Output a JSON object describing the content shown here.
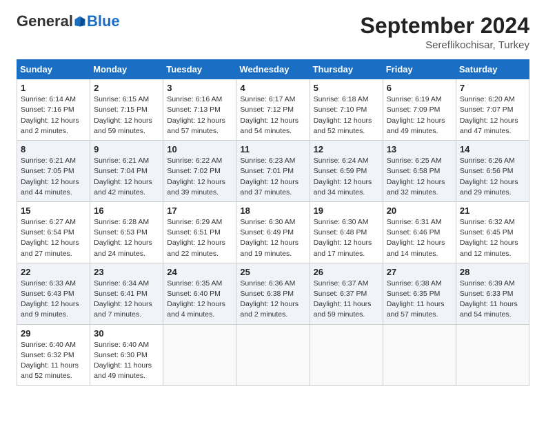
{
  "header": {
    "logo_general": "General",
    "logo_blue": "Blue",
    "month_year": "September 2024",
    "location": "Sereflikochisar, Turkey"
  },
  "weekdays": [
    "Sunday",
    "Monday",
    "Tuesday",
    "Wednesday",
    "Thursday",
    "Friday",
    "Saturday"
  ],
  "weeks": [
    [
      {
        "day": "1",
        "sunrise": "Sunrise: 6:14 AM",
        "sunset": "Sunset: 7:16 PM",
        "daylight": "Daylight: 12 hours and 2 minutes."
      },
      {
        "day": "2",
        "sunrise": "Sunrise: 6:15 AM",
        "sunset": "Sunset: 7:15 PM",
        "daylight": "Daylight: 12 hours and 59 minutes."
      },
      {
        "day": "3",
        "sunrise": "Sunrise: 6:16 AM",
        "sunset": "Sunset: 7:13 PM",
        "daylight": "Daylight: 12 hours and 57 minutes."
      },
      {
        "day": "4",
        "sunrise": "Sunrise: 6:17 AM",
        "sunset": "Sunset: 7:12 PM",
        "daylight": "Daylight: 12 hours and 54 minutes."
      },
      {
        "day": "5",
        "sunrise": "Sunrise: 6:18 AM",
        "sunset": "Sunset: 7:10 PM",
        "daylight": "Daylight: 12 hours and 52 minutes."
      },
      {
        "day": "6",
        "sunrise": "Sunrise: 6:19 AM",
        "sunset": "Sunset: 7:09 PM",
        "daylight": "Daylight: 12 hours and 49 minutes."
      },
      {
        "day": "7",
        "sunrise": "Sunrise: 6:20 AM",
        "sunset": "Sunset: 7:07 PM",
        "daylight": "Daylight: 12 hours and 47 minutes."
      }
    ],
    [
      {
        "day": "8",
        "sunrise": "Sunrise: 6:21 AM",
        "sunset": "Sunset: 7:05 PM",
        "daylight": "Daylight: 12 hours and 44 minutes."
      },
      {
        "day": "9",
        "sunrise": "Sunrise: 6:21 AM",
        "sunset": "Sunset: 7:04 PM",
        "daylight": "Daylight: 12 hours and 42 minutes."
      },
      {
        "day": "10",
        "sunrise": "Sunrise: 6:22 AM",
        "sunset": "Sunset: 7:02 PM",
        "daylight": "Daylight: 12 hours and 39 minutes."
      },
      {
        "day": "11",
        "sunrise": "Sunrise: 6:23 AM",
        "sunset": "Sunset: 7:01 PM",
        "daylight": "Daylight: 12 hours and 37 minutes."
      },
      {
        "day": "12",
        "sunrise": "Sunrise: 6:24 AM",
        "sunset": "Sunset: 6:59 PM",
        "daylight": "Daylight: 12 hours and 34 minutes."
      },
      {
        "day": "13",
        "sunrise": "Sunrise: 6:25 AM",
        "sunset": "Sunset: 6:58 PM",
        "daylight": "Daylight: 12 hours and 32 minutes."
      },
      {
        "day": "14",
        "sunrise": "Sunrise: 6:26 AM",
        "sunset": "Sunset: 6:56 PM",
        "daylight": "Daylight: 12 hours and 29 minutes."
      }
    ],
    [
      {
        "day": "15",
        "sunrise": "Sunrise: 6:27 AM",
        "sunset": "Sunset: 6:54 PM",
        "daylight": "Daylight: 12 hours and 27 minutes."
      },
      {
        "day": "16",
        "sunrise": "Sunrise: 6:28 AM",
        "sunset": "Sunset: 6:53 PM",
        "daylight": "Daylight: 12 hours and 24 minutes."
      },
      {
        "day": "17",
        "sunrise": "Sunrise: 6:29 AM",
        "sunset": "Sunset: 6:51 PM",
        "daylight": "Daylight: 12 hours and 22 minutes."
      },
      {
        "day": "18",
        "sunrise": "Sunrise: 6:30 AM",
        "sunset": "Sunset: 6:49 PM",
        "daylight": "Daylight: 12 hours and 19 minutes."
      },
      {
        "day": "19",
        "sunrise": "Sunrise: 6:30 AM",
        "sunset": "Sunset: 6:48 PM",
        "daylight": "Daylight: 12 hours and 17 minutes."
      },
      {
        "day": "20",
        "sunrise": "Sunrise: 6:31 AM",
        "sunset": "Sunset: 6:46 PM",
        "daylight": "Daylight: 12 hours and 14 minutes."
      },
      {
        "day": "21",
        "sunrise": "Sunrise: 6:32 AM",
        "sunset": "Sunset: 6:45 PM",
        "daylight": "Daylight: 12 hours and 12 minutes."
      }
    ],
    [
      {
        "day": "22",
        "sunrise": "Sunrise: 6:33 AM",
        "sunset": "Sunset: 6:43 PM",
        "daylight": "Daylight: 12 hours and 9 minutes."
      },
      {
        "day": "23",
        "sunrise": "Sunrise: 6:34 AM",
        "sunset": "Sunset: 6:41 PM",
        "daylight": "Daylight: 12 hours and 7 minutes."
      },
      {
        "day": "24",
        "sunrise": "Sunrise: 6:35 AM",
        "sunset": "Sunset: 6:40 PM",
        "daylight": "Daylight: 12 hours and 4 minutes."
      },
      {
        "day": "25",
        "sunrise": "Sunrise: 6:36 AM",
        "sunset": "Sunset: 6:38 PM",
        "daylight": "Daylight: 12 hours and 2 minutes."
      },
      {
        "day": "26",
        "sunrise": "Sunrise: 6:37 AM",
        "sunset": "Sunset: 6:37 PM",
        "daylight": "Daylight: 11 hours and 59 minutes."
      },
      {
        "day": "27",
        "sunrise": "Sunrise: 6:38 AM",
        "sunset": "Sunset: 6:35 PM",
        "daylight": "Daylight: 11 hours and 57 minutes."
      },
      {
        "day": "28",
        "sunrise": "Sunrise: 6:39 AM",
        "sunset": "Sunset: 6:33 PM",
        "daylight": "Daylight: 11 hours and 54 minutes."
      }
    ],
    [
      {
        "day": "29",
        "sunrise": "Sunrise: 6:40 AM",
        "sunset": "Sunset: 6:32 PM",
        "daylight": "Daylight: 11 hours and 52 minutes."
      },
      {
        "day": "30",
        "sunrise": "Sunrise: 6:40 AM",
        "sunset": "Sunset: 6:30 PM",
        "daylight": "Daylight: 11 hours and 49 minutes."
      },
      null,
      null,
      null,
      null,
      null
    ]
  ]
}
